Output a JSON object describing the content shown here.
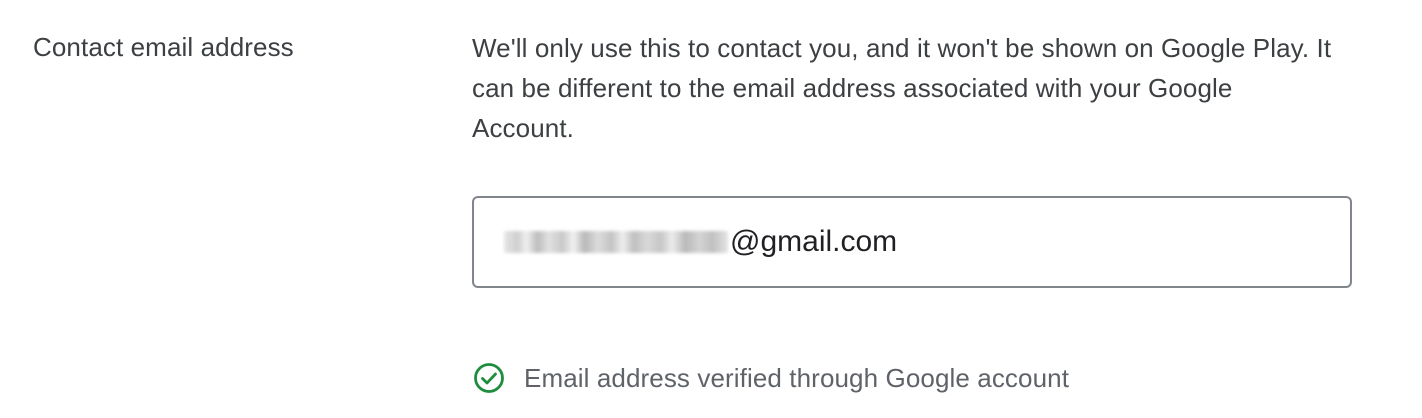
{
  "field": {
    "label": "Contact email address",
    "description": "We'll only use this to contact you, and it won't be shown on Google Play. It can be different to the email address associated with your Google Account."
  },
  "email": {
    "domain_part": "@gmail.com",
    "local_part_obscured": true
  },
  "verification": {
    "icon": "check-circle-icon",
    "text": "Email address verified through Google account",
    "color": "#1e8e3e"
  }
}
